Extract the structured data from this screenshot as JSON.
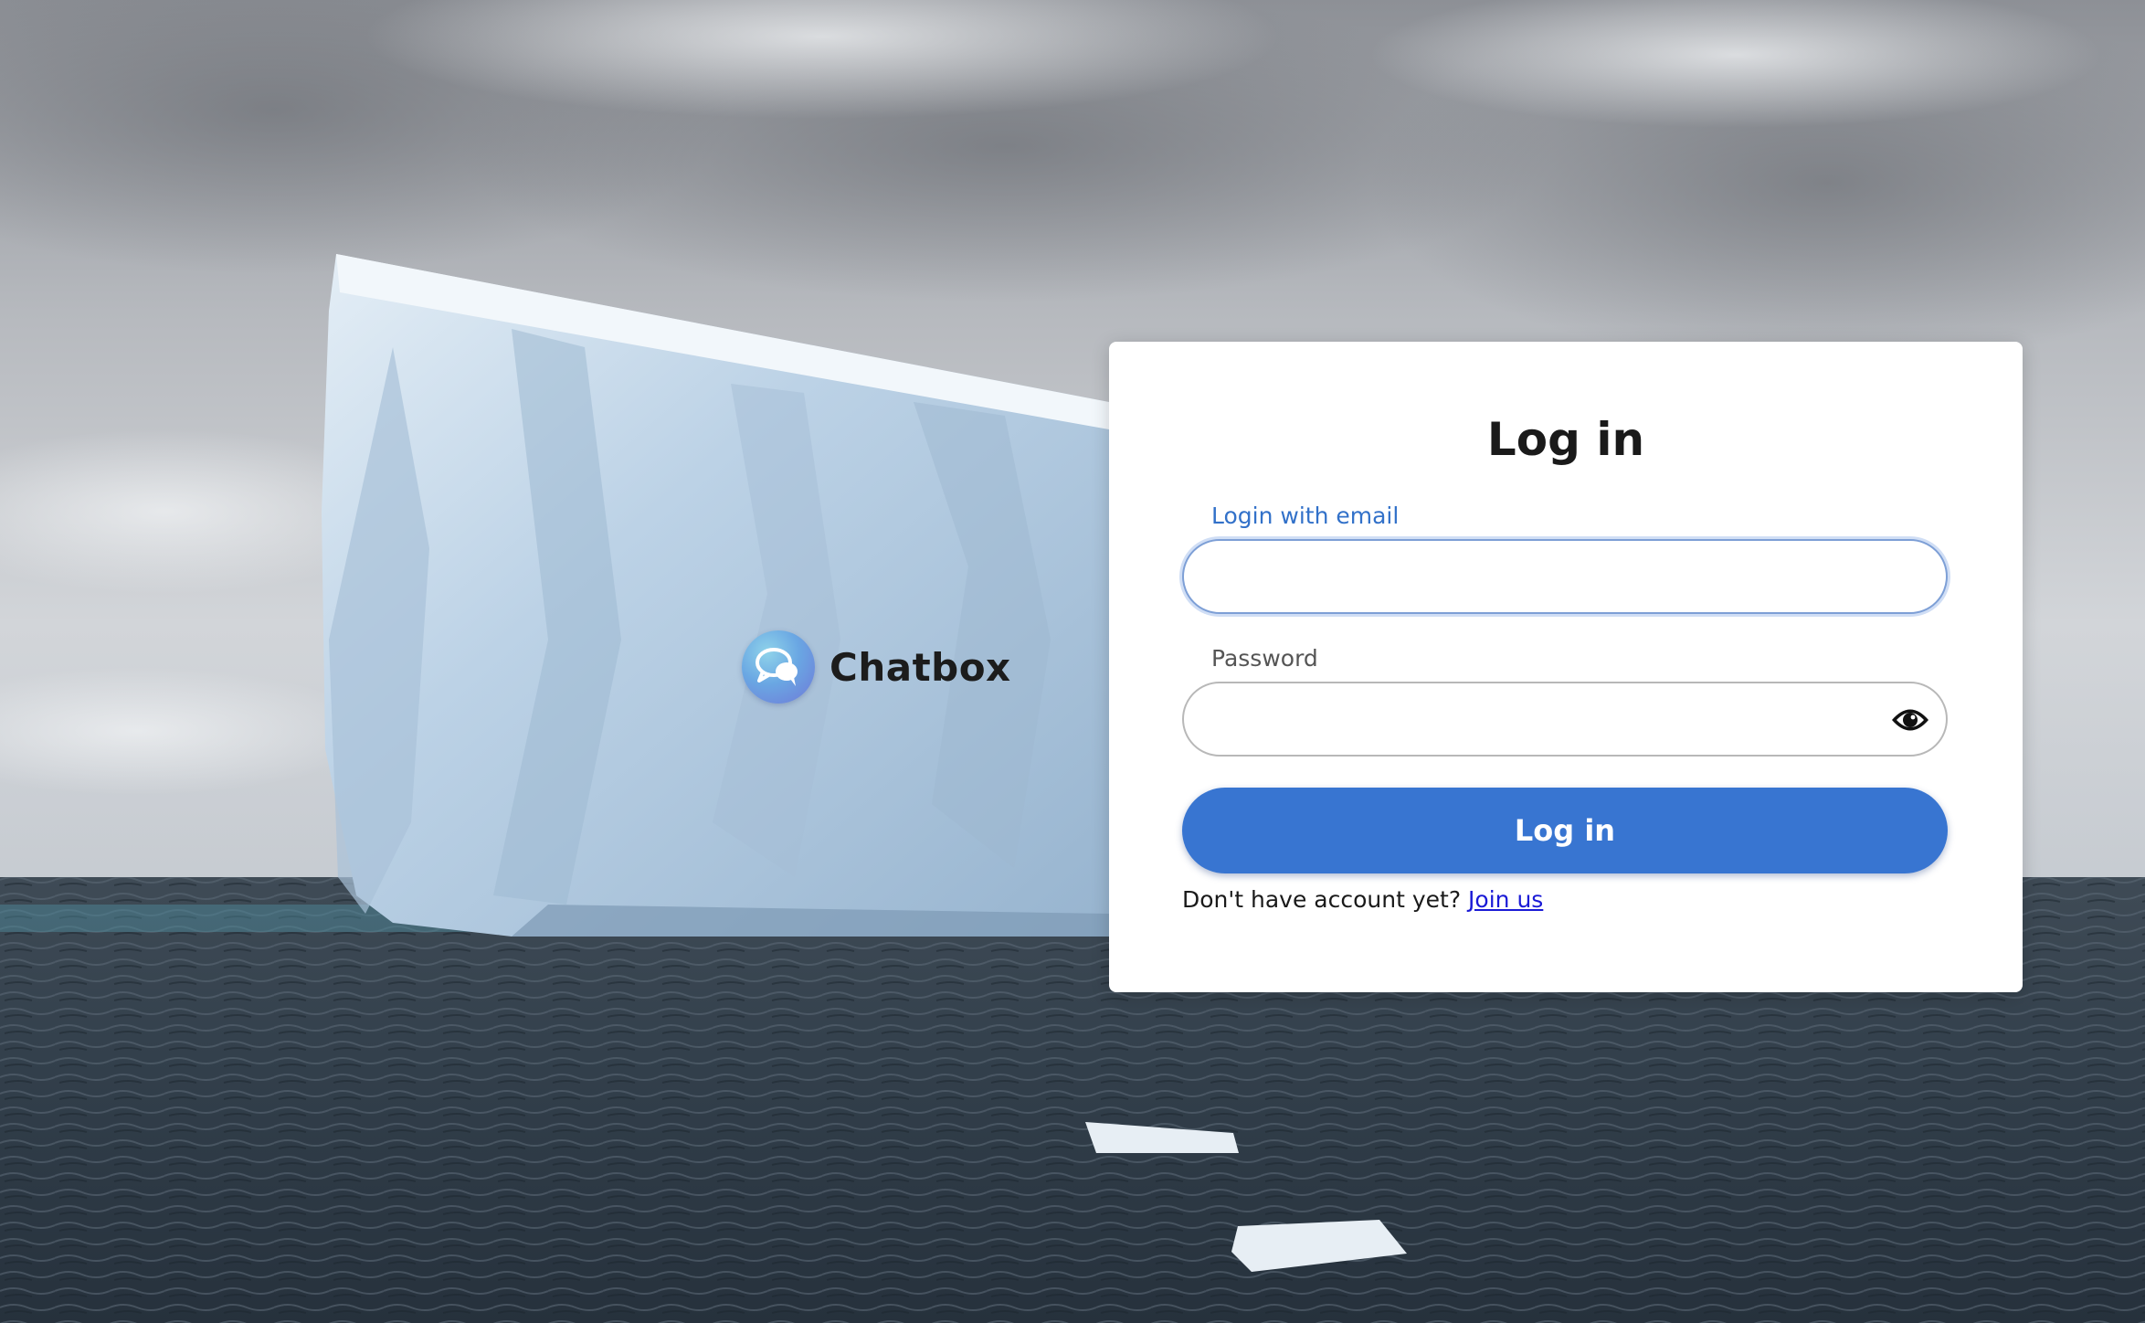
{
  "brand": {
    "name": "Chatbox",
    "logo_icon": "chat-bubbles-icon"
  },
  "login_card": {
    "title": "Log in",
    "email_field": {
      "label": "Login with email",
      "value": "",
      "placeholder": ""
    },
    "password_field": {
      "label": "Password",
      "value": "",
      "placeholder": "",
      "toggle_icon": "eye-icon"
    },
    "submit_label": "Log in",
    "signup_prompt": "Don't have account yet?",
    "signup_link": "Join us"
  },
  "colors": {
    "accent": "#3875d1",
    "email_label": "#3271c9",
    "link": "#1a1ad6"
  }
}
